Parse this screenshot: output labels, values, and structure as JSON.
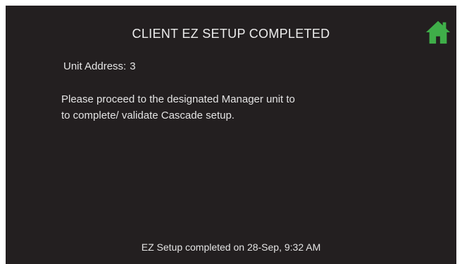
{
  "header": {
    "title": "CLIENT EZ SETUP COMPLETED",
    "home_icon": "home-icon",
    "home_color": "#3fae49"
  },
  "unit_address": {
    "label": "Unit Address:",
    "value": "3"
  },
  "message": {
    "line1": "Please proceed to the designated  Manager unit to",
    "line2": "to complete/ validate  Cascade setup."
  },
  "footer": {
    "status": "EZ Setup completed on 28-Sep, 9:32 AM"
  },
  "colors": {
    "background": "#231f20",
    "text": "#e4e4e4",
    "accent": "#3fae49"
  }
}
